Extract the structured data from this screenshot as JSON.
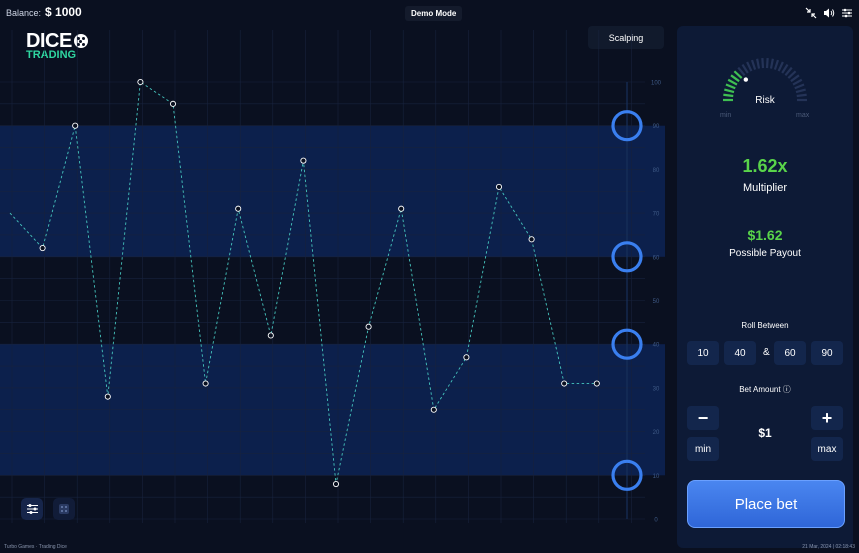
{
  "header": {
    "balance_label": "Balance:",
    "balance_value": "$ 1000",
    "mode": "Demo Mode"
  },
  "logo": {
    "line1": "DICE",
    "line2": "TRADING"
  },
  "toolbar": {
    "mode_button": "Scalping"
  },
  "chart_data": {
    "type": "line",
    "y_ticks": [
      "0",
      "10",
      "20",
      "30",
      "40",
      "50",
      "60",
      "70",
      "80",
      "90",
      "100"
    ],
    "ylim": [
      0,
      100
    ],
    "values": [
      70,
      62,
      90,
      28,
      100,
      95,
      31,
      71,
      42,
      82,
      8,
      44,
      71,
      25,
      37,
      76,
      64,
      31,
      31
    ],
    "ranges": [
      [
        10,
        40
      ],
      [
        60,
        90
      ]
    ],
    "markers": [
      90,
      60,
      40,
      10
    ],
    "colors": {
      "line": "#46c6bf",
      "band": "#0c2458",
      "marker": "#3a7fef"
    }
  },
  "panel": {
    "risk_label": "Risk",
    "gauge_min": "min",
    "gauge_max": "max",
    "multiplier": "1.62x",
    "multiplier_label": "Multiplier",
    "payout": "$1.62",
    "payout_label": "Possible Payout",
    "roll_between_label": "Roll Between",
    "roll_values": [
      "10",
      "40",
      "60",
      "90"
    ],
    "roll_sep": "&",
    "bet_amount_label": "Bet Amount",
    "minus": "−",
    "plus": "+",
    "min": "min",
    "max": "max",
    "bet_value": "$1",
    "place_bet": "Place bet"
  },
  "footer": {
    "left": "Turbo Games · Trading Dice",
    "right": "21 Mar, 2024 | 02:18:43"
  }
}
